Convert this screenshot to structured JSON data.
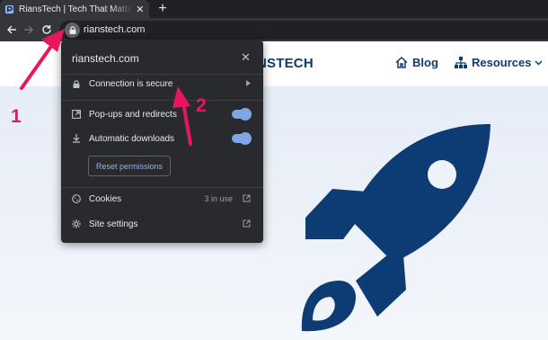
{
  "browser": {
    "tab": {
      "title": "RiansTech | Tech That Matters Th"
    },
    "omnibox": {
      "url": "rianstech.com"
    }
  },
  "site": {
    "brand": "NSTECH",
    "nav": {
      "blog": "Blog",
      "resources": "Resources"
    }
  },
  "popup": {
    "domain": "rianstech.com",
    "connection": "Connection is secure",
    "popups": "Pop-ups and redirects",
    "downloads": "Automatic downloads",
    "reset": "Reset permissions",
    "cookies": "Cookies",
    "cookies_count": "3 in use",
    "site_settings": "Site settings"
  },
  "annotations": {
    "marker1": "1",
    "marker2": "2"
  },
  "colors": {
    "accent": "#e8175d",
    "brand": "#0d3b73",
    "toggle": "#8ab4f8"
  }
}
